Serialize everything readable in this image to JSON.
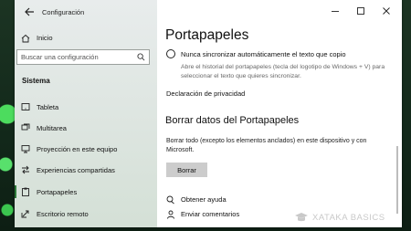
{
  "window": {
    "app_title": "Configuración",
    "controls": [
      "minimize",
      "maximize",
      "close"
    ]
  },
  "sidebar": {
    "home_label": "Inicio",
    "search_placeholder": "Buscar una configuración",
    "section_title": "Sistema",
    "items": [
      {
        "label": "Tableta",
        "icon": "tablet-icon"
      },
      {
        "label": "Multitarea",
        "icon": "multitasking-icon"
      },
      {
        "label": "Proyección en este equipo",
        "icon": "projection-icon"
      },
      {
        "label": "Experiencias compartidas",
        "icon": "shared-experiences-icon"
      },
      {
        "label": "Portapapeles",
        "icon": "clipboard-icon",
        "active": true
      },
      {
        "label": "Escritorio remoto",
        "icon": "remote-desktop-icon"
      }
    ]
  },
  "main": {
    "title": "Portapapeles",
    "sync_option": {
      "label": "Nunca sincronizar automáticamente el texto que copio",
      "selected": true
    },
    "sync_description": "Abre el historial del portapapeles (tecla del logotipo de Windows + V) para seleccionar el texto que quieres sincronizar.",
    "privacy_link": "Declaración de privacidad",
    "clear_title": "Borrar datos del Portapapeles",
    "clear_description": "Borrar todo (excepto los elementos anclados) en este dispositivo y con Microsoft.",
    "clear_button": "Borrar",
    "help_link": "Obtener ayuda",
    "feedback_link": "Enviar comentarios"
  },
  "watermark": {
    "text": "XATAKA BASICS"
  },
  "colors": {
    "accent": "#2d7a3a",
    "button_bg": "#cccccc",
    "sidebar_bg": "#e3e9e5"
  }
}
